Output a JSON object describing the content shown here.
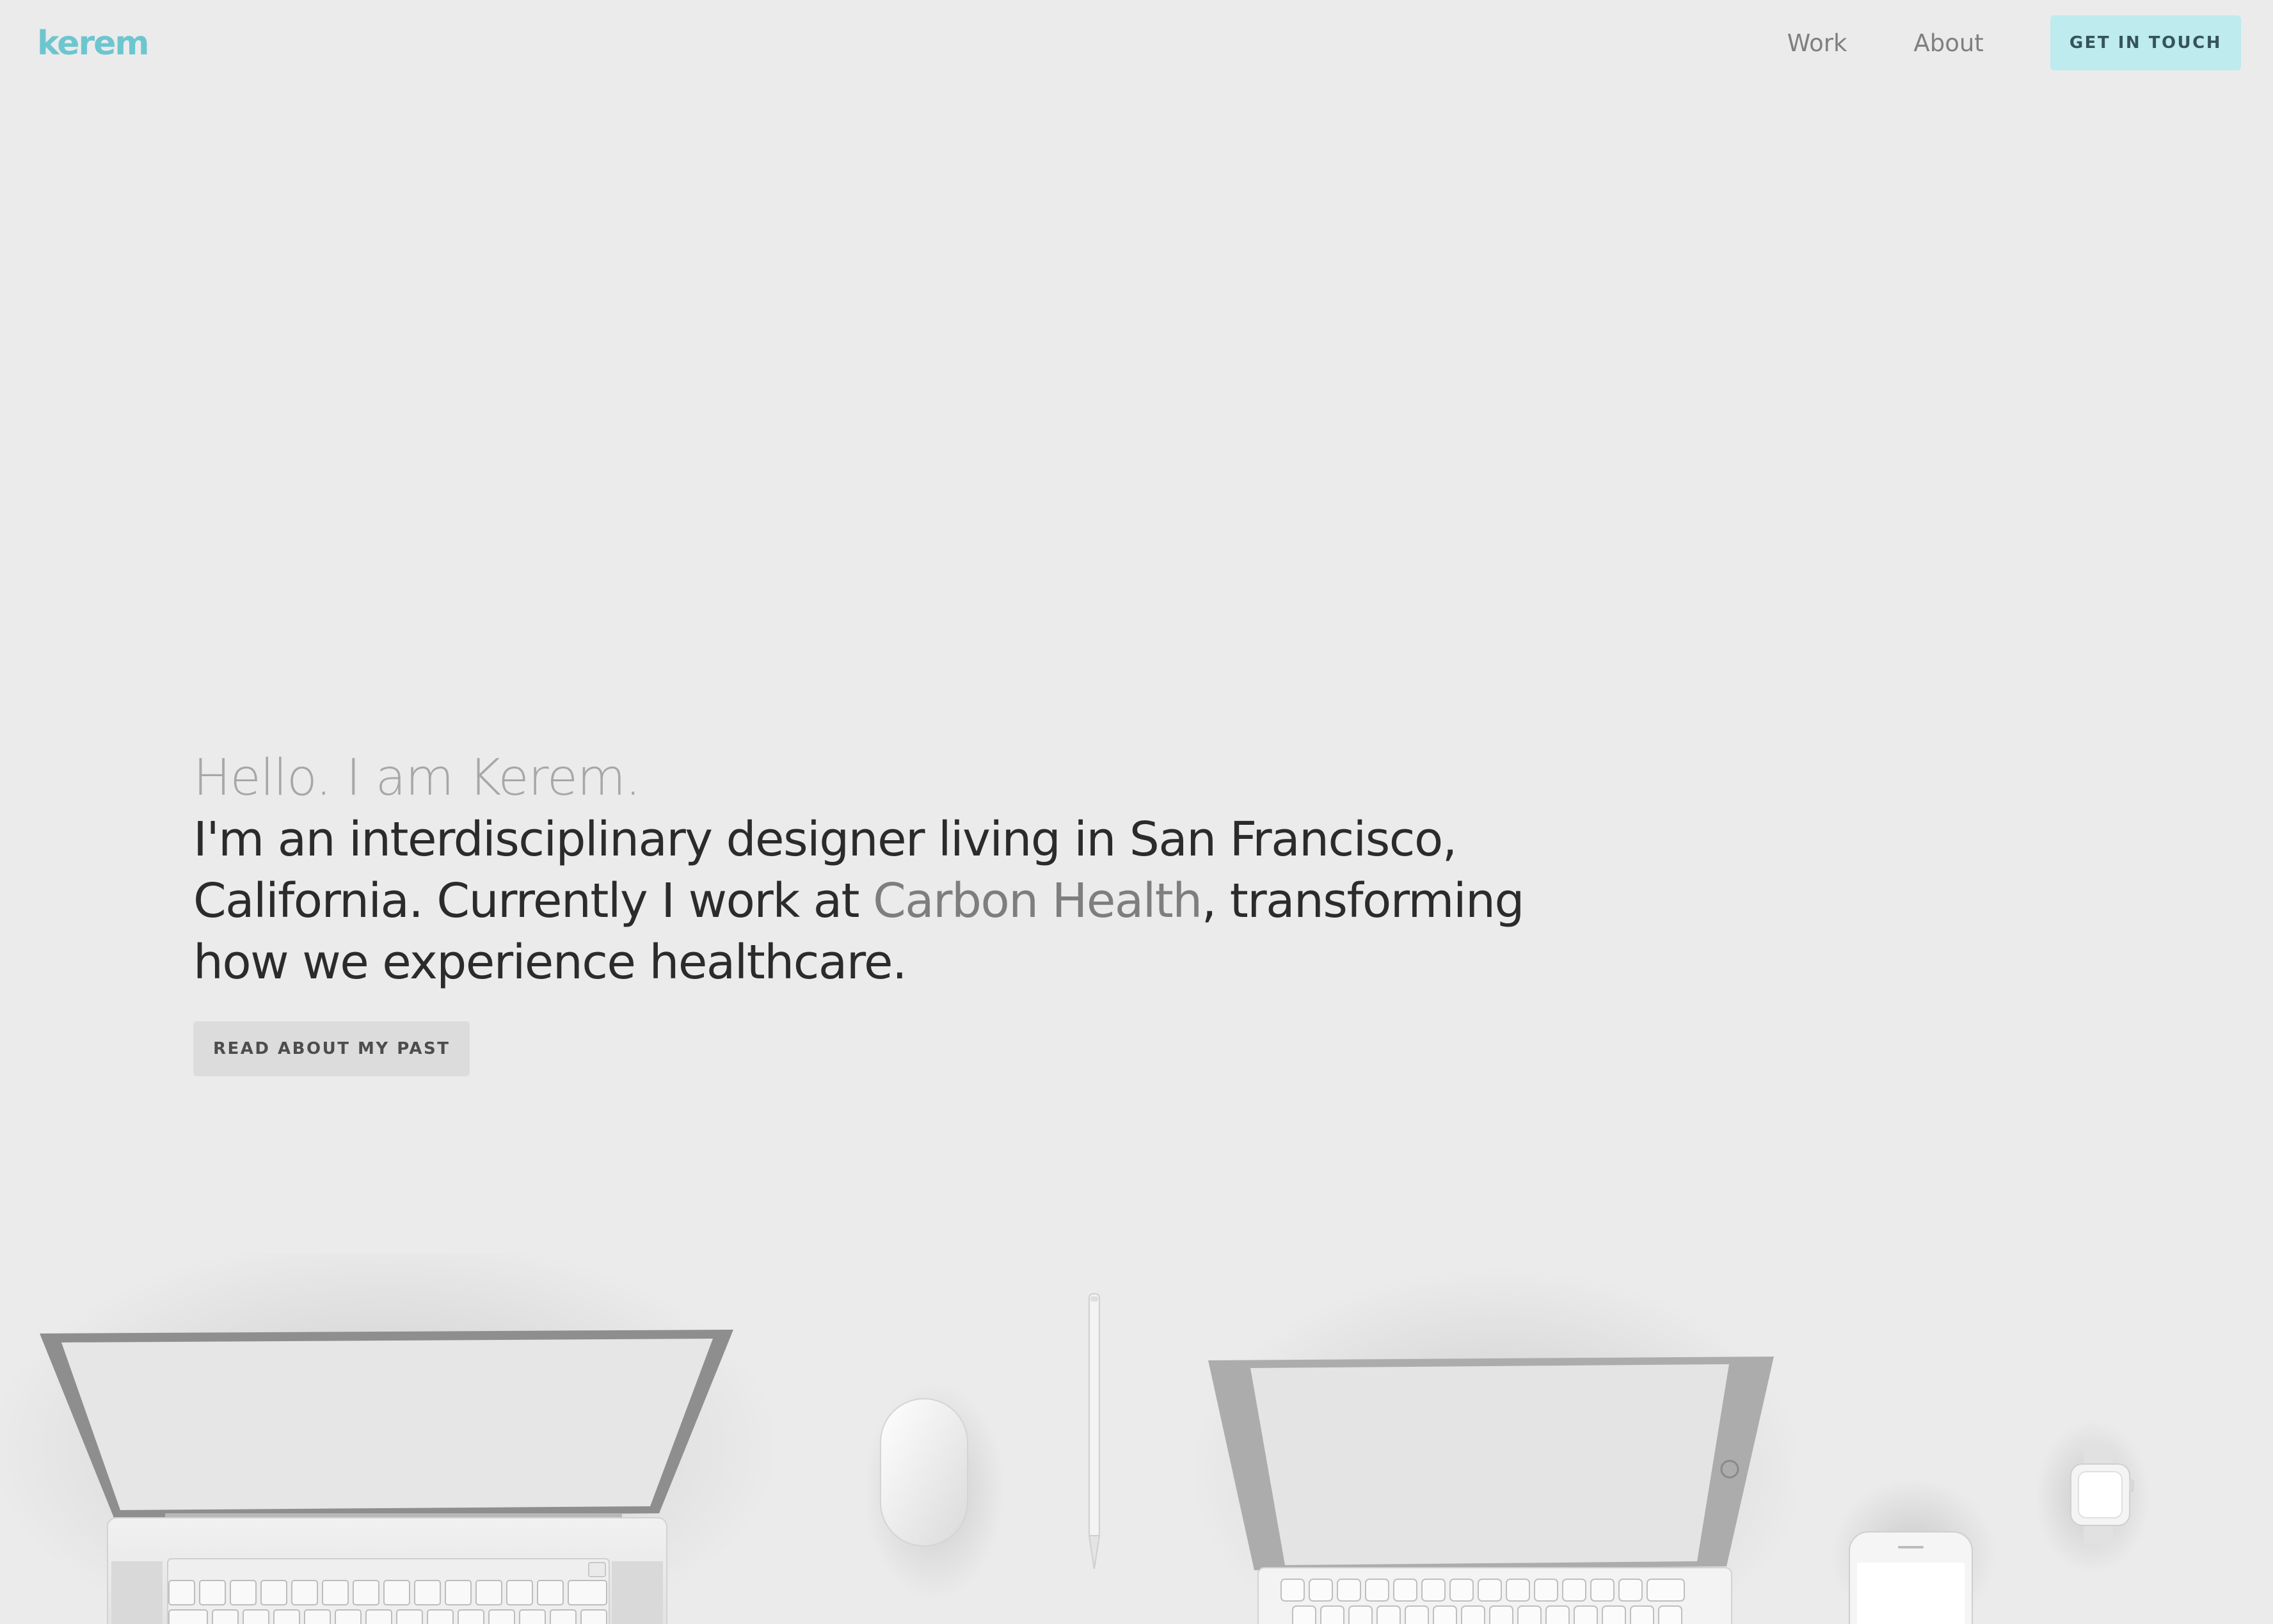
{
  "nav": {
    "logo": "kerem",
    "links": [
      "Work",
      "About"
    ],
    "cta": "GET IN TOUCH"
  },
  "hero": {
    "greeting": "Hello. I am Kerem.",
    "intro_before": "I'm an interdisciplinary designer living in San Francisco, California. Currently I work at ",
    "company": "Carbon Health",
    "intro_after": ", transforming how we experience healthcare.",
    "button": "READ ABOUT MY PAST"
  },
  "colors": {
    "background": "#ebebeb",
    "accent": "#6cc6cf",
    "cta_background": "#bdebee",
    "text": "#2b2b2b",
    "muted": "#a7a7a7"
  }
}
